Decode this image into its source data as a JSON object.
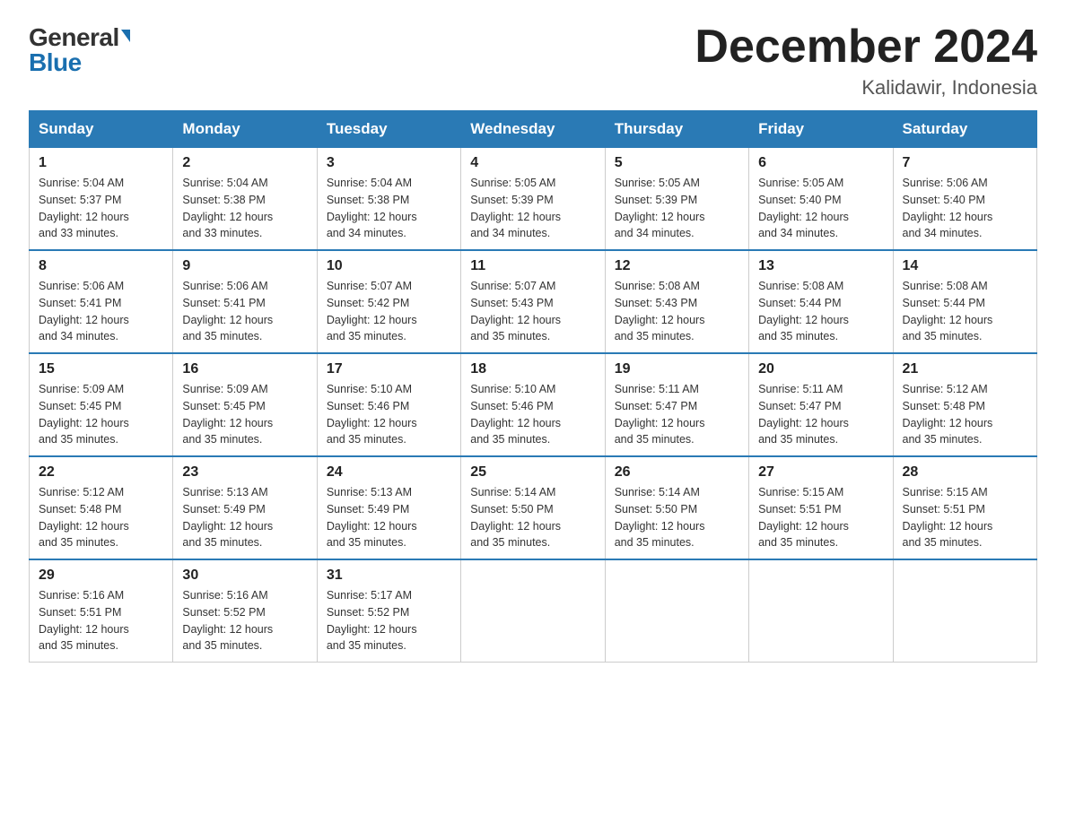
{
  "header": {
    "logo_general": "General",
    "logo_blue": "Blue",
    "title": "December 2024",
    "subtitle": "Kalidawir, Indonesia"
  },
  "days_of_week": [
    "Sunday",
    "Monday",
    "Tuesday",
    "Wednesday",
    "Thursday",
    "Friday",
    "Saturday"
  ],
  "weeks": [
    [
      {
        "day": "1",
        "sunrise": "5:04 AM",
        "sunset": "5:37 PM",
        "daylight": "12 hours and 33 minutes."
      },
      {
        "day": "2",
        "sunrise": "5:04 AM",
        "sunset": "5:38 PM",
        "daylight": "12 hours and 33 minutes."
      },
      {
        "day": "3",
        "sunrise": "5:04 AM",
        "sunset": "5:38 PM",
        "daylight": "12 hours and 34 minutes."
      },
      {
        "day": "4",
        "sunrise": "5:05 AM",
        "sunset": "5:39 PM",
        "daylight": "12 hours and 34 minutes."
      },
      {
        "day": "5",
        "sunrise": "5:05 AM",
        "sunset": "5:39 PM",
        "daylight": "12 hours and 34 minutes."
      },
      {
        "day": "6",
        "sunrise": "5:05 AM",
        "sunset": "5:40 PM",
        "daylight": "12 hours and 34 minutes."
      },
      {
        "day": "7",
        "sunrise": "5:06 AM",
        "sunset": "5:40 PM",
        "daylight": "12 hours and 34 minutes."
      }
    ],
    [
      {
        "day": "8",
        "sunrise": "5:06 AM",
        "sunset": "5:41 PM",
        "daylight": "12 hours and 34 minutes."
      },
      {
        "day": "9",
        "sunrise": "5:06 AM",
        "sunset": "5:41 PM",
        "daylight": "12 hours and 35 minutes."
      },
      {
        "day": "10",
        "sunrise": "5:07 AM",
        "sunset": "5:42 PM",
        "daylight": "12 hours and 35 minutes."
      },
      {
        "day": "11",
        "sunrise": "5:07 AM",
        "sunset": "5:43 PM",
        "daylight": "12 hours and 35 minutes."
      },
      {
        "day": "12",
        "sunrise": "5:08 AM",
        "sunset": "5:43 PM",
        "daylight": "12 hours and 35 minutes."
      },
      {
        "day": "13",
        "sunrise": "5:08 AM",
        "sunset": "5:44 PM",
        "daylight": "12 hours and 35 minutes."
      },
      {
        "day": "14",
        "sunrise": "5:08 AM",
        "sunset": "5:44 PM",
        "daylight": "12 hours and 35 minutes."
      }
    ],
    [
      {
        "day": "15",
        "sunrise": "5:09 AM",
        "sunset": "5:45 PM",
        "daylight": "12 hours and 35 minutes."
      },
      {
        "day": "16",
        "sunrise": "5:09 AM",
        "sunset": "5:45 PM",
        "daylight": "12 hours and 35 minutes."
      },
      {
        "day": "17",
        "sunrise": "5:10 AM",
        "sunset": "5:46 PM",
        "daylight": "12 hours and 35 minutes."
      },
      {
        "day": "18",
        "sunrise": "5:10 AM",
        "sunset": "5:46 PM",
        "daylight": "12 hours and 35 minutes."
      },
      {
        "day": "19",
        "sunrise": "5:11 AM",
        "sunset": "5:47 PM",
        "daylight": "12 hours and 35 minutes."
      },
      {
        "day": "20",
        "sunrise": "5:11 AM",
        "sunset": "5:47 PM",
        "daylight": "12 hours and 35 minutes."
      },
      {
        "day": "21",
        "sunrise": "5:12 AM",
        "sunset": "5:48 PM",
        "daylight": "12 hours and 35 minutes."
      }
    ],
    [
      {
        "day": "22",
        "sunrise": "5:12 AM",
        "sunset": "5:48 PM",
        "daylight": "12 hours and 35 minutes."
      },
      {
        "day": "23",
        "sunrise": "5:13 AM",
        "sunset": "5:49 PM",
        "daylight": "12 hours and 35 minutes."
      },
      {
        "day": "24",
        "sunrise": "5:13 AM",
        "sunset": "5:49 PM",
        "daylight": "12 hours and 35 minutes."
      },
      {
        "day": "25",
        "sunrise": "5:14 AM",
        "sunset": "5:50 PM",
        "daylight": "12 hours and 35 minutes."
      },
      {
        "day": "26",
        "sunrise": "5:14 AM",
        "sunset": "5:50 PM",
        "daylight": "12 hours and 35 minutes."
      },
      {
        "day": "27",
        "sunrise": "5:15 AM",
        "sunset": "5:51 PM",
        "daylight": "12 hours and 35 minutes."
      },
      {
        "day": "28",
        "sunrise": "5:15 AM",
        "sunset": "5:51 PM",
        "daylight": "12 hours and 35 minutes."
      }
    ],
    [
      {
        "day": "29",
        "sunrise": "5:16 AM",
        "sunset": "5:51 PM",
        "daylight": "12 hours and 35 minutes."
      },
      {
        "day": "30",
        "sunrise": "5:16 AM",
        "sunset": "5:52 PM",
        "daylight": "12 hours and 35 minutes."
      },
      {
        "day": "31",
        "sunrise": "5:17 AM",
        "sunset": "5:52 PM",
        "daylight": "12 hours and 35 minutes."
      },
      null,
      null,
      null,
      null
    ]
  ]
}
